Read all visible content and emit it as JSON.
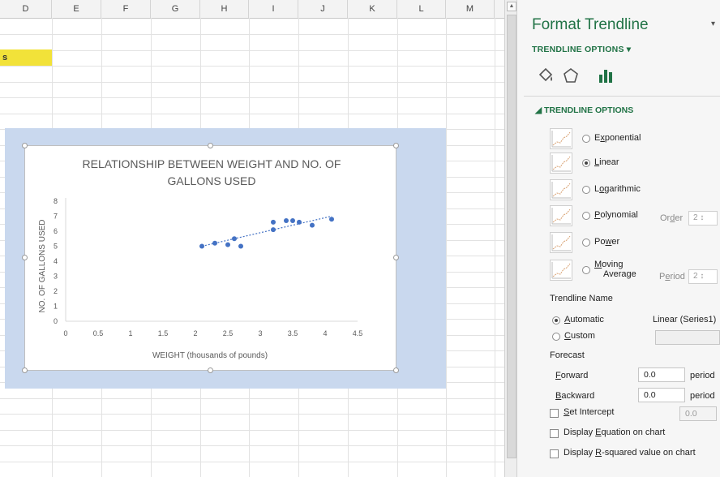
{
  "columns": [
    "D",
    "E",
    "F",
    "G",
    "H",
    "I",
    "J",
    "K",
    "L",
    "M"
  ],
  "cell_s": "s",
  "colors": {
    "accent": "#217346",
    "highlight": "#f2e239",
    "chart_bg": "#c9d8ee",
    "series": "#4472c4"
  },
  "chart_data": {
    "type": "scatter",
    "title_line1": "RELATIONSHIP BETWEEN WEIGHT AND NO. OF",
    "title_line2": "GALLONS USED",
    "xlabel": "WEIGHT (thousands of pounds)",
    "ylabel": "NO. OF GALLONS USED",
    "xlim": [
      0,
      4.5
    ],
    "ylim": [
      0,
      8
    ],
    "xticks": [
      "0",
      "0.5",
      "1",
      "1.5",
      "2",
      "2.5",
      "3",
      "3.5",
      "4",
      "4.5"
    ],
    "yticks": [
      "0",
      "1",
      "2",
      "3",
      "4",
      "5",
      "6",
      "7",
      "8"
    ],
    "points": [
      {
        "x": 2.1,
        "y": 5.0
      },
      {
        "x": 2.3,
        "y": 5.2
      },
      {
        "x": 2.5,
        "y": 5.1
      },
      {
        "x": 2.6,
        "y": 5.5
      },
      {
        "x": 2.7,
        "y": 5.0
      },
      {
        "x": 3.2,
        "y": 6.1
      },
      {
        "x": 3.2,
        "y": 6.6
      },
      {
        "x": 3.4,
        "y": 6.7
      },
      {
        "x": 3.5,
        "y": 6.7
      },
      {
        "x": 3.6,
        "y": 6.6
      },
      {
        "x": 3.8,
        "y": 6.4
      },
      {
        "x": 4.1,
        "y": 6.8
      }
    ],
    "trendline": {
      "x": [
        2.1,
        4.1
      ],
      "y": [
        5.0,
        7.0
      ]
    },
    "grid": false,
    "legend": "none"
  },
  "panel": {
    "title": "Format Trendline",
    "close_icon": "▾",
    "subtitle": "TRENDLINE OPTIONS ▾",
    "section": "◢ TRENDLINE OPTIONS",
    "options": [
      {
        "pre": "E",
        "u": "x",
        "post": "ponential",
        "selected": false
      },
      {
        "pre": "",
        "u": "L",
        "post": "inear",
        "selected": true
      },
      {
        "pre": "L",
        "u": "o",
        "post": "garithmic",
        "selected": false
      },
      {
        "pre": "",
        "u": "P",
        "post": "olynomial",
        "selected": false
      },
      {
        "pre": "Po",
        "u": "w",
        "post": "er",
        "selected": false
      },
      {
        "pre": "",
        "u": "M",
        "post": "oving",
        "selected": false
      }
    ],
    "moving_line2": "Average",
    "order_label_pre": "Or",
    "order_label_u": "d",
    "order_label_post": "er",
    "order_value": "2",
    "period_label_pre": "P",
    "period_label_u": "e",
    "period_label_post": "riod",
    "period_value": "2",
    "trendline_name": "Trendline Name",
    "automatic_pre": "",
    "automatic_u": "A",
    "automatic_post": "utomatic",
    "automatic_value": "Linear (Series1)",
    "custom_pre": "",
    "custom_u": "C",
    "custom_post": "ustom",
    "forecast": "Forecast",
    "forward_pre": "",
    "forward_u": "F",
    "forward_post": "orward",
    "forward_value": "0.0",
    "forward_unit": "period",
    "backward_pre": "",
    "backward_u": "B",
    "backward_post": "ackward",
    "backward_value": "0.0",
    "backward_unit": "period",
    "set_intercept_pre": "",
    "set_intercept_u": "S",
    "set_intercept_post": "et Intercept",
    "intercept_value": "0.0",
    "display_eq_pre": "Display ",
    "display_eq_u": "E",
    "display_eq_post": "quation on chart",
    "display_r2_pre": "Display ",
    "display_r2_u": "R",
    "display_r2_post": "-squared value on chart"
  }
}
